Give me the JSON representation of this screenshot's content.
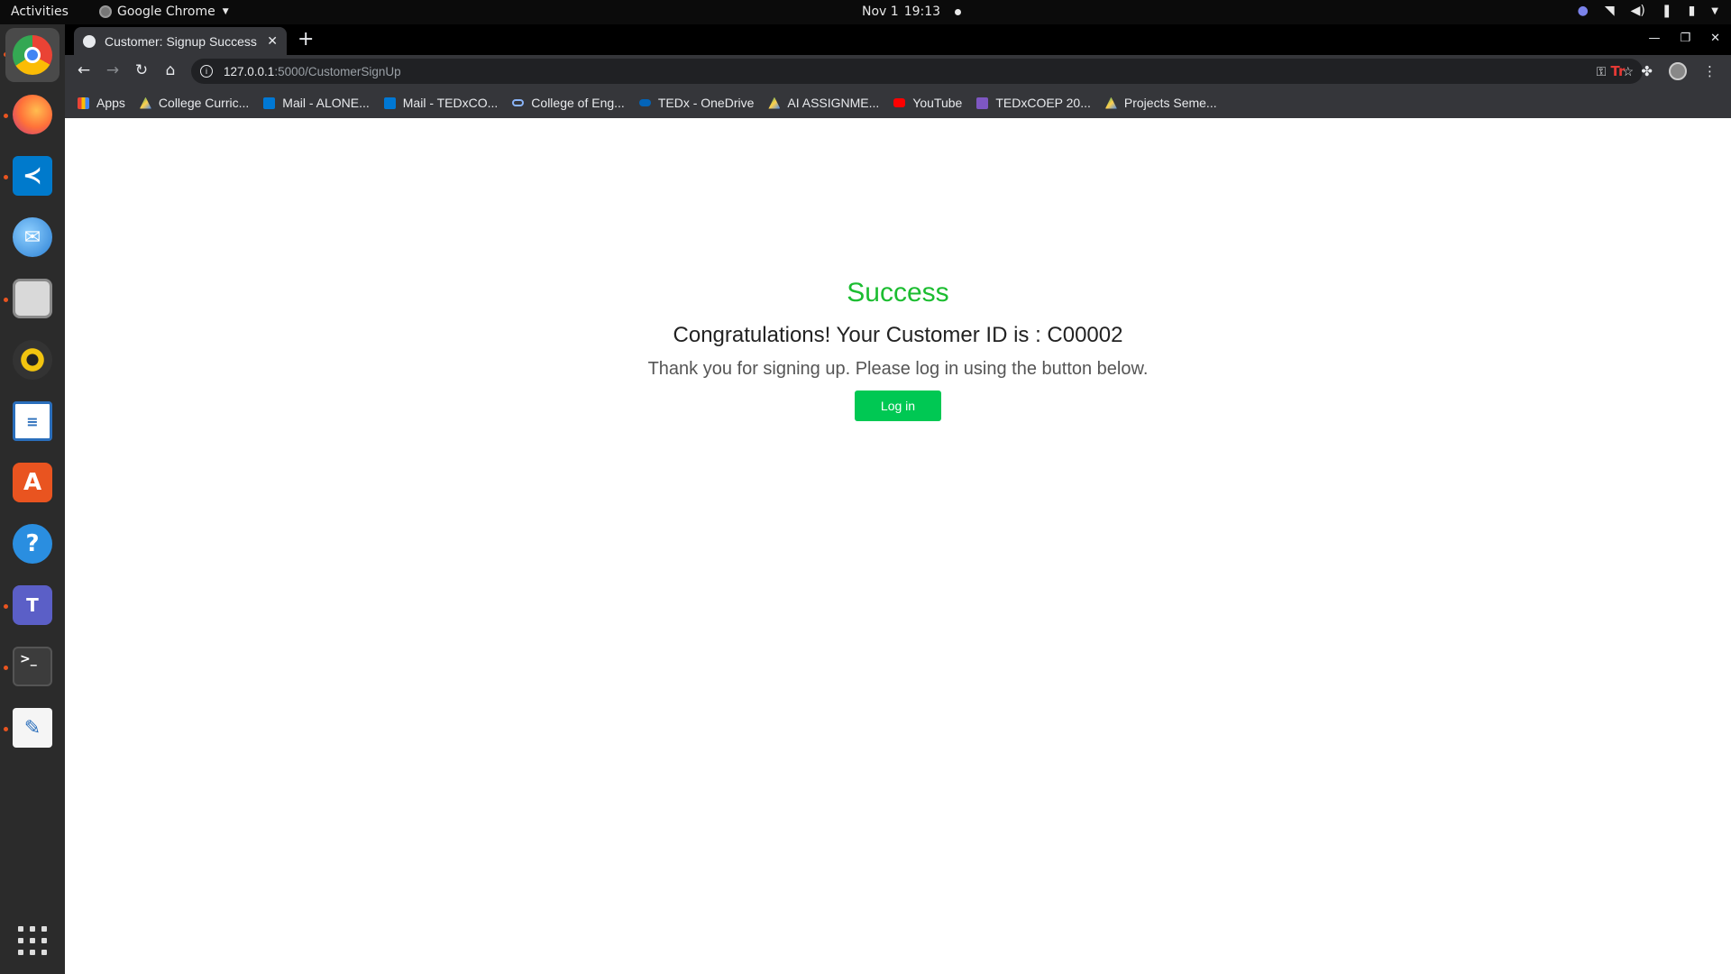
{
  "topbar": {
    "activities": "Activities",
    "app_name": "Google Chrome",
    "date": "Nov 1",
    "time": "19:13"
  },
  "dock": {
    "items": [
      {
        "name": "chrome",
        "color": "#4285f4"
      },
      {
        "name": "firefox",
        "color": "#ff7139"
      },
      {
        "name": "vscode",
        "color": "#007acc"
      },
      {
        "name": "thunderbird",
        "color": "#2a7fd4"
      },
      {
        "name": "files",
        "color": "#d9d9d9"
      },
      {
        "name": "rhythmbox",
        "color": "#f2c40f"
      },
      {
        "name": "writer",
        "color": "#2a6ebb"
      },
      {
        "name": "software",
        "color": "#e95420"
      },
      {
        "name": "help",
        "color": "#2a8ee0"
      },
      {
        "name": "teams",
        "color": "#5b5fc7"
      },
      {
        "name": "terminal",
        "color": "#3c3c3c"
      },
      {
        "name": "text-editor",
        "color": "#f5f5f5"
      }
    ]
  },
  "browser": {
    "tab_title": "Customer: Signup Success",
    "url_host": "127.0.0.1",
    "url_path": ":5000/CustomerSignUp",
    "bookmarks": [
      {
        "label": "Apps",
        "color": "#4285f4"
      },
      {
        "label": "College Curric...",
        "color": "#1fa463"
      },
      {
        "label": "Mail - ALONE...",
        "color": "#0078d4"
      },
      {
        "label": "Mail - TEDxCO...",
        "color": "#0078d4"
      },
      {
        "label": "College of Eng...",
        "color": "#8ab4f8"
      },
      {
        "label": "TEDx - OneDrive",
        "color": "#0364b8"
      },
      {
        "label": "AI ASSIGNME...",
        "color": "#1fa463"
      },
      {
        "label": "YouTube",
        "color": "#ff0000"
      },
      {
        "label": "TEDxCOEP 20...",
        "color": "#7e57c2"
      },
      {
        "label": "Projects Seme...",
        "color": "#1fa463"
      }
    ]
  },
  "page": {
    "heading": "Success",
    "subheading": "Congratulations! Your Customer ID is : C00002",
    "message": "Thank you for signing up. Please log in using the button below.",
    "login_label": "Log in"
  },
  "colors": {
    "success_green": "#1cbd31",
    "button_green": "#00c853"
  }
}
